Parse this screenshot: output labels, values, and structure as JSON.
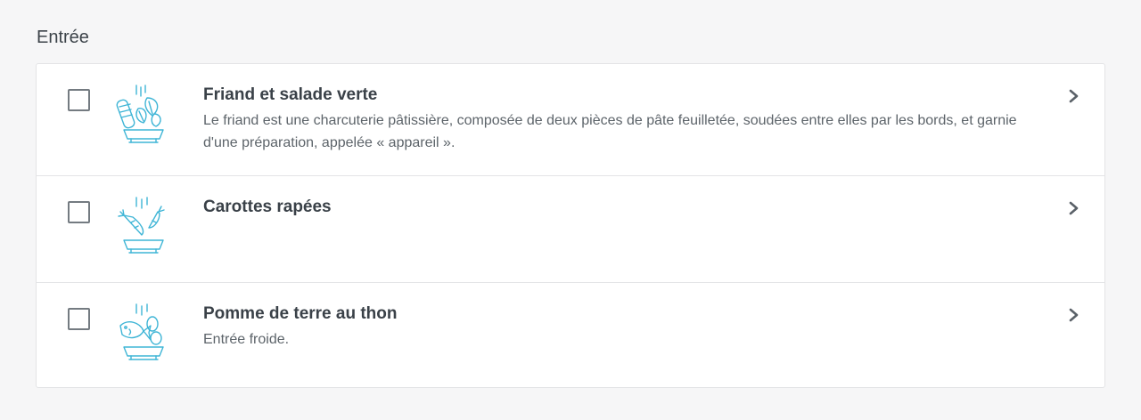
{
  "section": {
    "title": "Entrée"
  },
  "items": [
    {
      "title": "Friand et salade verte",
      "description": "Le friand est une charcuterie pâtissière, composée de deux pièces de pâte feuilletée, soudées entre elles par les bords, et garnie d'une préparation, appelée « appareil ».",
      "icon": "salad-bowl-icon",
      "checked": false
    },
    {
      "title": "Carottes rapées",
      "description": "",
      "icon": "carrot-bowl-icon",
      "checked": false
    },
    {
      "title": "Pomme de terre au thon",
      "description": "Entrée froide.",
      "icon": "fish-potato-bowl-icon",
      "checked": false
    }
  ],
  "colors": {
    "icon": "#3fb5d6",
    "border": "#e3e4e6",
    "text": "#3a4148"
  }
}
